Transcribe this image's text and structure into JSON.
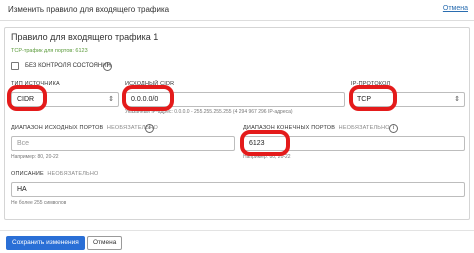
{
  "window": {
    "title": "Изменить правило для входящего трафика",
    "help_link": "Отмена"
  },
  "panel": {
    "title": "Правило для входящего трафика 1",
    "subtitle": "TCP-трафик для портов: 6123"
  },
  "stateless": {
    "label": "БЕЗ КОНТРОЛЯ СОСТОЯНИЯ",
    "checked": false
  },
  "source_type": {
    "label": "ТИП ИСТОЧНИКА",
    "value": "CIDR"
  },
  "source_cidr": {
    "label": "ИСХОДНЫЙ CIDR",
    "value": "0.0.0.0/0",
    "hint": "Указанный IP-адрес: 0.0.0.0 - 255.255.255.255 (4 294 967 296 IP-адреса)"
  },
  "ip_protocol": {
    "label": "IP-ПРОТОКОЛ",
    "value": "TCP"
  },
  "source_port": {
    "label": "ДИАПАЗОН ИСХОДНЫХ ПОРТОВ",
    "optional": "НЕОБЯЗАТЕЛЬНО",
    "placeholder": "Все",
    "hint": "Например: 80, 20-22"
  },
  "dest_port": {
    "label": "ДИАПАЗОН КОНЕЧНЫХ ПОРТОВ",
    "optional": "НЕОБЯЗАТЕЛЬНО",
    "value": "6123",
    "hint": "Например: 80, 20-22"
  },
  "description": {
    "label": "ОПИСАНИЕ",
    "optional": "НЕОБЯЗАТЕЛЬНО",
    "value": "HA",
    "hint": "Не более 255 символов"
  },
  "buttons": {
    "save": "Сохранить изменения",
    "cancel": "Отмена"
  },
  "icons": {
    "info": "info-icon",
    "chevron": "chevron-updown-icon"
  },
  "colors": {
    "accent": "#2a6fd6",
    "highlight": "#e41b1b"
  }
}
